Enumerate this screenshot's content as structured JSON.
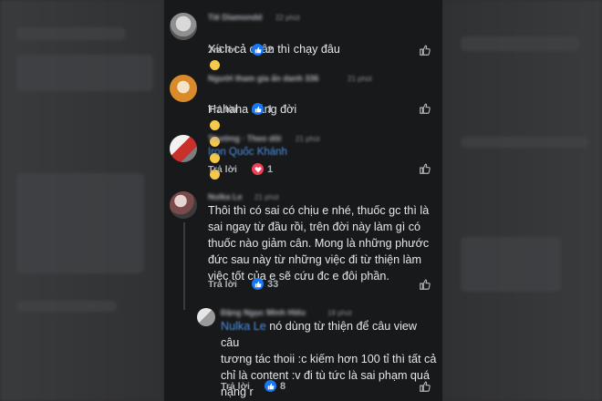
{
  "comments": [
    {
      "author": "Tiê Diamondd",
      "time": "22 phút",
      "text": "Xích cả chân thì chạy đâu",
      "emojis": [
        "thinking"
      ],
      "reply_label": "Trả lời",
      "reaction": "like",
      "reaction_count": "2"
    },
    {
      "author": "Người tham gia ẩn danh 336",
      "time": "21 phút",
      "text": "Hahaha đáng đời",
      "emojis": [
        "joy",
        "joy",
        "joy",
        "joy"
      ],
      "reply_label": "Trả lời",
      "reaction": "like",
      "reaction_count": "1"
    },
    {
      "author": "Thường · Theo dõi",
      "time": "21 phút",
      "mention": "Iron Quốc Khánh",
      "text": "",
      "reply_label": "Trả lời",
      "reaction": "love",
      "reaction_count": "1"
    },
    {
      "author": "Nulka Le",
      "time": "21 phút",
      "text": "Thôi thì có sai có chịu e nhé, thuốc gc thì là\nsai ngay từ đầu rồi, trên đời này làm gì có\nthuốc nào giảm cân. Mong là những phước\nđức sau này từ những việc đi từ thiện làm\nviệc tốt của e sẽ cứu đc e đôi phần.",
      "reply_label": "Trả lời",
      "reaction": "like",
      "reaction_count": "33"
    },
    {
      "author": "Đặng Ngọc Minh Hiếu",
      "time": "18 phút",
      "mention": "Nulka Le",
      "text": " nó dùng từ thiện để câu view câu\ntương tác thoii :c kiếm hơn 100 tỉ thì tất cả\nchỉ là content :v đi tù tức là sai phạm quá\nnặng r",
      "reply_label": "Trả lời",
      "reaction": "like",
      "reaction_count": "8"
    }
  ],
  "colors": {
    "like": "#1877f2",
    "love": "#f33e58",
    "mention": "#4a90e2"
  }
}
